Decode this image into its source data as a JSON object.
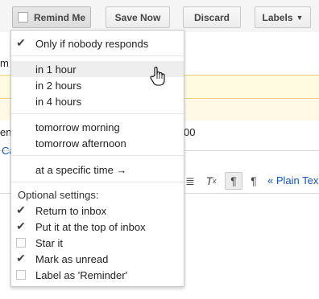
{
  "toolbar": {
    "remind_label": "Remind Me",
    "save_label": "Save Now",
    "discard_label": "Discard",
    "labels_label": "Labels"
  },
  "background": {
    "text_mid_left": "ent",
    "text_mid_right": "00",
    "link_left": "Ca",
    "plain_text_link": "« Plain Tex",
    "field_left": "m"
  },
  "menu": {
    "only_if_nobody": "Only if nobody responds",
    "times": [
      "in 1 hour",
      "in 2 hours",
      "in 4 hours"
    ],
    "days": [
      "tomorrow morning",
      "tomorrow afternoon"
    ],
    "specific_time": "at a specific time →",
    "optional_heading": "Optional settings:",
    "options": [
      {
        "label": "Return to inbox",
        "checked": true
      },
      {
        "label": "Put it at the top of inbox",
        "checked": true
      },
      {
        "label": "Star it",
        "checked": false
      },
      {
        "label": "Mark as unread",
        "checked": true
      },
      {
        "label": "Label as 'Reminder'",
        "checked": false
      }
    ]
  }
}
